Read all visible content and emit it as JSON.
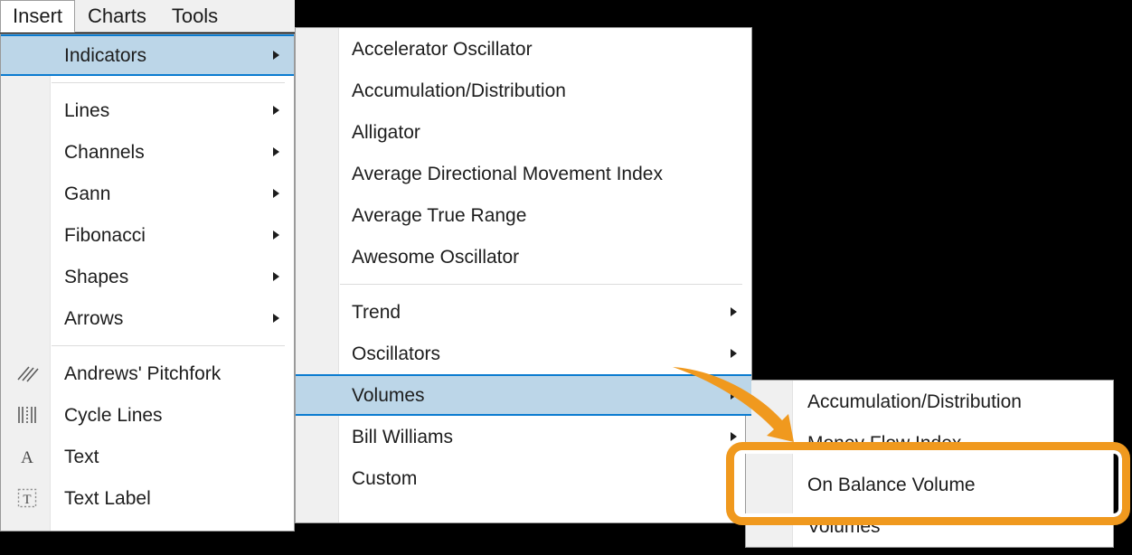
{
  "app": {
    "background_color": "#000000",
    "accent_select": "#bcd6e8",
    "accent_select_border": "#0a7bd0",
    "highlight_color": "#f0991e"
  },
  "menubar": {
    "items": [
      {
        "label": "Insert",
        "active": true
      },
      {
        "label": "Charts",
        "active": false
      },
      {
        "label": "Tools",
        "active": false
      }
    ]
  },
  "insert_menu": {
    "items": [
      {
        "label": "Indicators",
        "submenu": true,
        "selected": true,
        "icon": ""
      },
      {
        "separator": true
      },
      {
        "label": "Lines",
        "submenu": true,
        "icon": ""
      },
      {
        "label": "Channels",
        "submenu": true,
        "icon": ""
      },
      {
        "label": "Gann",
        "submenu": true,
        "icon": ""
      },
      {
        "label": "Fibonacci",
        "submenu": true,
        "icon": ""
      },
      {
        "label": "Shapes",
        "submenu": true,
        "icon": ""
      },
      {
        "label": "Arrows",
        "submenu": true,
        "icon": ""
      },
      {
        "separator": true
      },
      {
        "label": "Andrews' Pitchfork",
        "submenu": false,
        "icon": "pitchfork-icon"
      },
      {
        "label": "Cycle Lines",
        "submenu": false,
        "icon": "cycle-lines-icon"
      },
      {
        "label": "Text",
        "submenu": false,
        "icon": "text-a-icon"
      },
      {
        "label": "Text Label",
        "submenu": false,
        "icon": "text-label-icon"
      }
    ]
  },
  "indicators_menu": {
    "items": [
      {
        "label": "Accelerator Oscillator",
        "submenu": false
      },
      {
        "label": "Accumulation/Distribution",
        "submenu": false
      },
      {
        "label": "Alligator",
        "submenu": false
      },
      {
        "label": "Average Directional Movement Index",
        "submenu": false
      },
      {
        "label": "Average True Range",
        "submenu": false
      },
      {
        "label": "Awesome Oscillator",
        "submenu": false
      },
      {
        "separator": true
      },
      {
        "label": "Trend",
        "submenu": true
      },
      {
        "label": "Oscillators",
        "submenu": true
      },
      {
        "label": "Volumes",
        "submenu": true,
        "selected": true
      },
      {
        "label": "Bill Williams",
        "submenu": true
      },
      {
        "label": "Custom",
        "submenu": true
      }
    ]
  },
  "volumes_menu": {
    "items": [
      {
        "label": "Accumulation/Distribution",
        "submenu": false
      },
      {
        "label": "Money Flow Index",
        "submenu": false
      },
      {
        "label": "On Balance Volume",
        "submenu": false,
        "highlighted": true
      },
      {
        "label": "Volumes",
        "submenu": false
      }
    ]
  },
  "annotation": {
    "arrow": "curved-arrow-icon",
    "target_label": "On Balance Volume"
  }
}
